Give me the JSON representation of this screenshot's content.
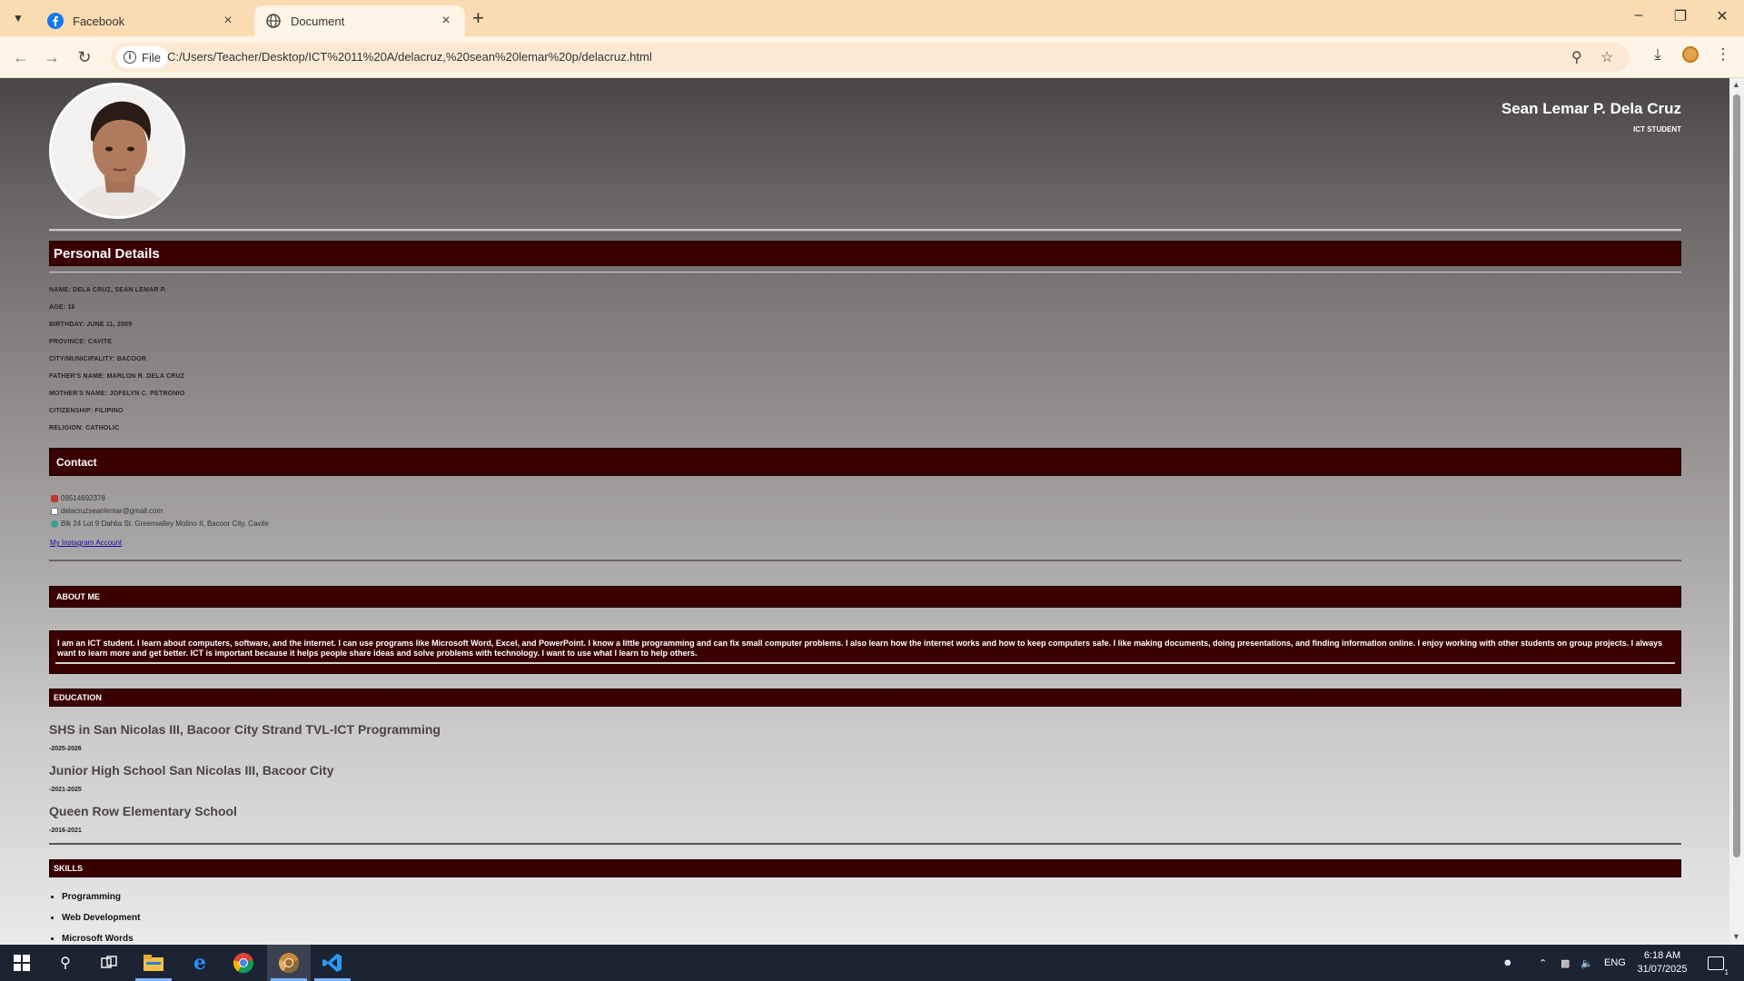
{
  "browser": {
    "tabs": [
      {
        "title": "Facebook",
        "active": false
      },
      {
        "title": "Document",
        "active": true
      }
    ],
    "address": {
      "chip": "File",
      "url": "C:/Users/Teacher/Desktop/ICT%2011%20A/delacruz,%20sean%20lemar%20p/delacruz.html"
    }
  },
  "header": {
    "name": "Sean Lemar P. Dela Cruz",
    "role": "ICT STUDENT"
  },
  "personal": {
    "title": "Personal Details",
    "items": [
      "NAME: DELA CRUZ, SEAN LEMAR P.",
      "AGE: 16",
      "BIRTHDAY: JUNE 11, 2009",
      "PROVINCE: CAVITE",
      "CITY/MUNICIPALITY: BACOOR",
      "FATHER'S NAME: MARLON R. DELA CRUZ",
      "MOTHER'S NAME: JOFELYN C. PETRONIO",
      "CITIZENSHIP: FILIPINO",
      "RELIGION: CATHOLIC"
    ]
  },
  "contact": {
    "title": "Contact",
    "phone": "09514692378",
    "email": "delacruzseanlemar@gmail.com",
    "address": "Blk 24 Lot 9 Dahlia St. Greenvalley Molino II, Bacoor City, Cavite",
    "link": "My Instagram Account"
  },
  "about": {
    "title": "ABOUT ME",
    "text": "I am an ICT student. I learn about computers, software, and the internet. I can use programs like Microsoft Word, Excel, and PowerPoint. I know a little programming and can fix small computer problems. I also learn how the internet works and how to keep computers safe. I like making documents, doing presentations, and finding information online. I enjoy working with other students on group projects. I always want to learn more and get better. ICT is important because it helps people share ideas and solve problems with technology. I want to use what I learn to help others."
  },
  "education": {
    "title": "EDUCATION",
    "entries": [
      {
        "school": "SHS in San Nicolas III, Bacoor City Strand TVL-ICT Programming",
        "years": "-2025-2026"
      },
      {
        "school": "Junior High School San Nicolas III, Bacoor City",
        "years": "-2021-2025"
      },
      {
        "school": "Queen Row Elementary School",
        "years": "-2016-2021"
      }
    ]
  },
  "skills": {
    "title": "SKILLS",
    "items": [
      "Programming",
      "Web Development",
      "Microsoft Words"
    ]
  },
  "taskbar": {
    "lang": "ENG",
    "time": "6:18 AM",
    "date": "31/07/2025",
    "notifications": "1"
  },
  "icons": {
    "facebook": "facebook-icon",
    "globe": "globe-icon",
    "colors": {
      "section": "#3a0000",
      "chrome": "#fbdcb2"
    }
  }
}
